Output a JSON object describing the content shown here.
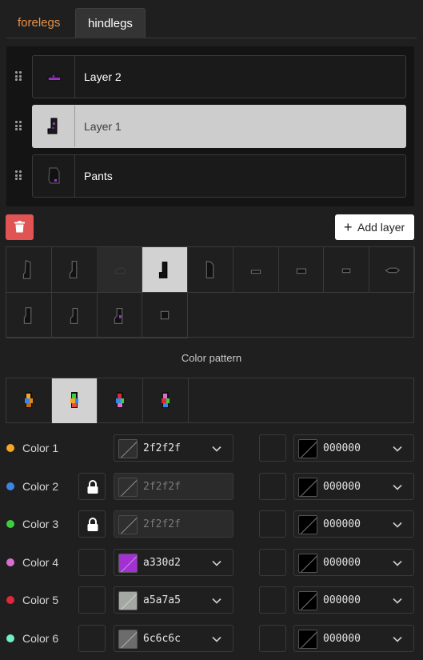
{
  "tabs": [
    {
      "label": "forelegs",
      "active": false
    },
    {
      "label": "hindlegs",
      "active": true
    }
  ],
  "layers": [
    {
      "name": "Layer 2",
      "selected": false,
      "thumb_icon": "small-shape-icon"
    },
    {
      "name": "Layer 1",
      "selected": true,
      "thumb_icon": "leg-shape-icon"
    },
    {
      "name": "Pants",
      "selected": false,
      "thumb_icon": "pants-shape-icon"
    }
  ],
  "actions": {
    "add_layer_label": "Add layer",
    "delete_icon": "trash-icon",
    "add_icon": "plus-icon"
  },
  "shapes": {
    "count": 13,
    "selected_index": 3,
    "dimmed_index": 2
  },
  "color_pattern": {
    "title": "Color pattern",
    "count": 4,
    "selected_index": 1
  },
  "colors": [
    {
      "label": "Color 1",
      "dot": "#f5a623",
      "locked": false,
      "has_toggle": false,
      "value": "2f2f2f",
      "swatch": "#2f2f2f",
      "disabled": false,
      "outline": "000000"
    },
    {
      "label": "Color 2",
      "dot": "#3a86e8",
      "locked": true,
      "has_toggle": false,
      "value": "2f2f2f",
      "swatch": "#2f2f2f",
      "disabled": true,
      "outline": "000000"
    },
    {
      "label": "Color 3",
      "dot": "#3ccf3c",
      "locked": true,
      "has_toggle": false,
      "value": "2f2f2f",
      "swatch": "#2f2f2f",
      "disabled": true,
      "outline": "000000"
    },
    {
      "label": "Color 4",
      "dot": "#d86fd0",
      "locked": false,
      "has_toggle": true,
      "value": "a330d2",
      "swatch": "#a330d2",
      "disabled": false,
      "outline": "000000"
    },
    {
      "label": "Color 5",
      "dot": "#e0283c",
      "locked": false,
      "has_toggle": true,
      "value": "a5a7a5",
      "swatch": "#a5a7a5",
      "disabled": false,
      "outline": "000000"
    },
    {
      "label": "Color 6",
      "dot": "#6ff0c8",
      "locked": false,
      "has_toggle": true,
      "value": "6c6c6c",
      "swatch": "#6c6c6c",
      "disabled": false,
      "outline": "000000"
    }
  ],
  "palette": {
    "accent_tab": "#e8924a",
    "danger": "#e05454",
    "background": "#1f1f1f"
  }
}
